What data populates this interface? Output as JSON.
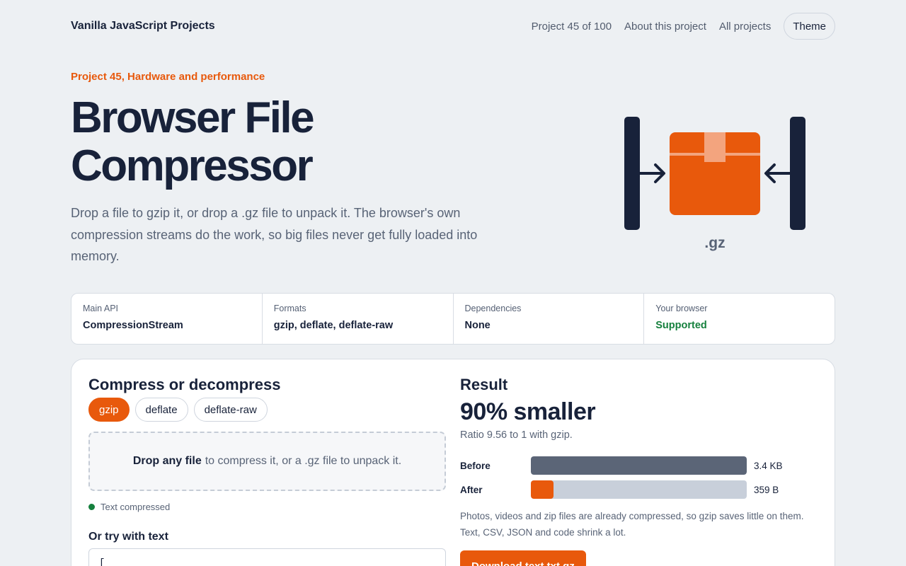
{
  "header": {
    "brand": "Vanilla JavaScript Projects",
    "nav": {
      "progress": "Project 45 of 100",
      "about": "About this project",
      "all": "All projects",
      "theme": "Theme"
    }
  },
  "hero": {
    "eyebrow": "Project 45, Hardware and performance",
    "title": "Browser File Compressor",
    "description": "Drop a file to gzip it, or drop a .gz file to unpack it. The browser's own compression streams do the work, so big files never get fully loaded into memory.",
    "art_caption": ".gz",
    "art_icon": "box-compress-icon"
  },
  "stats": [
    {
      "label": "Main API",
      "value": "CompressionStream"
    },
    {
      "label": "Formats",
      "value": "gzip, deflate, deflate-raw"
    },
    {
      "label": "Dependencies",
      "value": "None"
    },
    {
      "label": "Your browser",
      "value": "Supported"
    }
  ],
  "tool": {
    "heading": "Compress or decompress",
    "formats": [
      "gzip",
      "deflate",
      "deflate-raw"
    ],
    "selected_format": "gzip",
    "dropzone": {
      "strong": "Drop any file",
      "rest": "to compress it, or a .gz file to unpack it."
    },
    "status": "Text compressed",
    "try_label": "Or try with text",
    "textarea_value": "["
  },
  "result": {
    "heading": "Result",
    "headline": "90% smaller",
    "ratio": "Ratio 9.56 to 1 with gzip.",
    "before": {
      "label": "Before",
      "value": "3.4 KB",
      "fraction": 1.0
    },
    "after": {
      "label": "After",
      "value": "359 B",
      "fraction": 0.105
    },
    "note": "Photos, videos and zip files are already compressed, so gzip saves little on them. Text, CSV, JSON and code shrink a lot.",
    "download": "Download text.txt.gz"
  },
  "colors": {
    "accent": "#e8590c",
    "ink": "#18223a",
    "muted": "#586376",
    "success": "#15803d",
    "before_bar": "#5b6577",
    "track": "#c8cfda"
  }
}
